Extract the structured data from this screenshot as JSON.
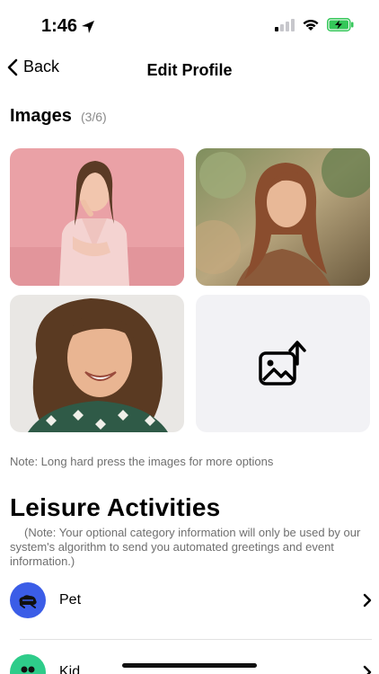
{
  "status_bar": {
    "time": "1:46"
  },
  "nav": {
    "back_label": "Back",
    "title": "Edit Profile"
  },
  "images": {
    "title": "Images",
    "count": "(3/6)",
    "note": "Note: Long hard press the images for more options"
  },
  "leisure": {
    "title": "Leisure Activities",
    "note": "(Note: Your optional category information will only be used by our system's algorithm to send you automated greetings and event information.)",
    "items": [
      {
        "label": "Pet",
        "icon": "pet-icon",
        "color": "#3b5de7"
      },
      {
        "label": "Kid",
        "icon": "kid-icon",
        "color": "#2ecc8a"
      }
    ]
  },
  "colors": {
    "accent_blue": "#3b5de7",
    "accent_green": "#2ecc8a",
    "battery_green": "#34c759",
    "tile_placeholder": "#f2f2f5"
  }
}
